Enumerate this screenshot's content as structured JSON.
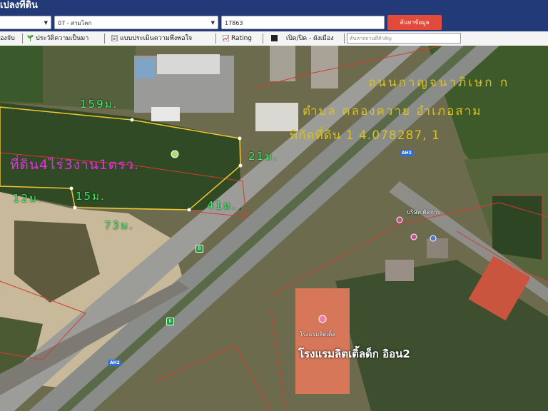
{
  "header": {
    "title": "เปลงที่ดิน",
    "district_select": "07 - สามโคก",
    "parcel_input": "17863",
    "search_button": "ค้นหาข้อมูล"
  },
  "toolbar": {
    "item_1": "องจับ",
    "item_2": "ประวัติความเป็นมา",
    "item_3": "แบบประเมินความพึงพอใจ",
    "item_4": "Rating",
    "item_5": "เปิด/ปิด - ผังเมือง",
    "place_search_placeholder": "ค้นหาสถานที่สำคัญ"
  },
  "map": {
    "road_name": "ถนนกาญจนาภิเษก ก",
    "subdistrict": "ตำบล คลองควาย อำเภอสาม",
    "coordinate": "พิกัดที่ดิน 1 4.078287,  1",
    "land_size": "ที่ดิน4ไร่3งาน1ตรว.",
    "measurements": {
      "m159": "159ม.",
      "m21": "21ม.",
      "m12": "12ม.",
      "m15": "15ม.",
      "m41": "41ม.",
      "m73": "73ม."
    },
    "hotel_name": "โรงแรมลิตเติ้ลด็ก อิอน2",
    "route_shield": "AH2",
    "poi_1": "บริษัท คิดการ",
    "poi_2": "โรงแรมลิตเติ้ล"
  }
}
